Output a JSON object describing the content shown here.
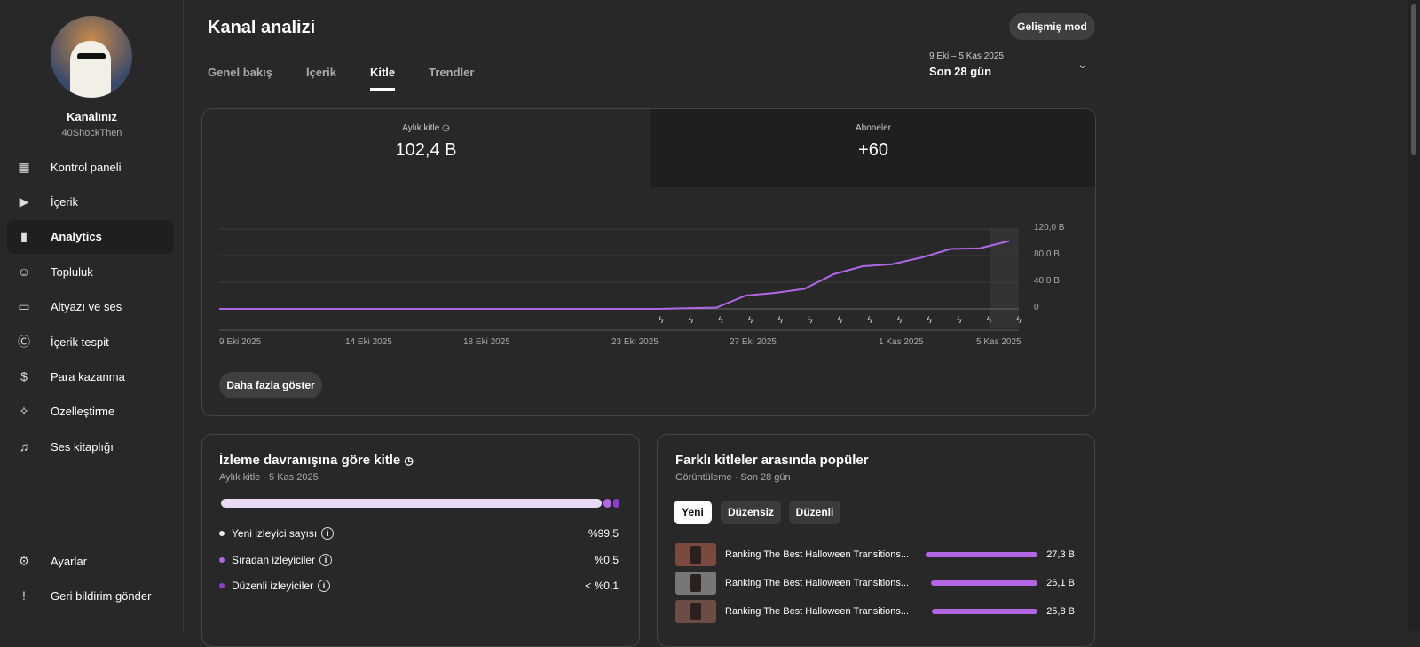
{
  "sidebar": {
    "channel_name": "Kanalınız",
    "handle": "40ShockThen",
    "items": [
      {
        "label": "Kontrol paneli",
        "icon": "dashboard-icon"
      },
      {
        "label": "İçerik",
        "icon": "content-icon"
      },
      {
        "label": "Analytics",
        "icon": "analytics-icon",
        "active": true
      },
      {
        "label": "Topluluk",
        "icon": "community-icon"
      },
      {
        "label": "Altyazı ve ses",
        "icon": "subtitles-icon"
      },
      {
        "label": "İçerik tespit",
        "icon": "copyright-icon"
      },
      {
        "label": "Para kazanma",
        "icon": "dollar-icon"
      },
      {
        "label": "Özelleştirme",
        "icon": "magic-wand-icon"
      },
      {
        "label": "Ses kitaplığı",
        "icon": "audio-library-icon"
      }
    ],
    "bottom": [
      {
        "label": "Ayarlar",
        "icon": "gear-icon"
      },
      {
        "label": "Geri bildirim gönder",
        "icon": "feedback-icon"
      }
    ]
  },
  "header": {
    "title": "Kanal analizi",
    "advanced_button": "Gelişmiş mod",
    "date_range": "9 Eki – 5 Kas 2025",
    "date_label": "Son 28 gün",
    "tabs": [
      {
        "label": "Genel bakış"
      },
      {
        "label": "İçerik"
      },
      {
        "label": "Kitle",
        "active": true
      },
      {
        "label": "Trendler"
      }
    ]
  },
  "metrics": [
    {
      "label": "Aylık kitle",
      "value": "102,4 B"
    },
    {
      "label": "Aboneler",
      "value": "+60"
    }
  ],
  "more_button": "Daha fazla göster",
  "chart_data": {
    "type": "line",
    "title": "Aylık kitle",
    "x_labels": [
      "9 Eki 2025",
      "14 Eki 2025",
      "18 Eki 2025",
      "23 Eki 2025",
      "27 Eki 2025",
      "1 Kas 2025",
      "5 Kas 2025"
    ],
    "y_ticks": [
      "0",
      "40,0 B",
      "80,0 B",
      "120,0 B"
    ],
    "ylim": [
      0,
      120
    ],
    "values": [
      0,
      0,
      0,
      0,
      0,
      0,
      0,
      0,
      0,
      0,
      0,
      0,
      0,
      0,
      0,
      0,
      1,
      2,
      20,
      24,
      30,
      52,
      64,
      67,
      77,
      90,
      91,
      102
    ],
    "color": "#b266e6"
  },
  "behavior": {
    "title": "İzleme davranışına göre kitle",
    "subtitle": "Aylık kitle · 5 Kas 2025",
    "rows": [
      {
        "label": "Yeni izleyici sayısı",
        "value": "%99,5",
        "color": "#e8daf5",
        "share": 99.5
      },
      {
        "label": "Sıradan izleyiciler",
        "value": "%0,5",
        "color": "#b266e6",
        "share": 0.5
      },
      {
        "label": "Düzenli izleyiciler",
        "value": "< %0,1",
        "color": "#8a3fcf",
        "share": 0.1
      }
    ]
  },
  "popular": {
    "title": "Farklı kitleler arasında popüler",
    "subtitle": "Görüntüleme · Son 28 gün",
    "chips": [
      "Yeni",
      "Düzensiz",
      "Düzenli"
    ],
    "videos": [
      {
        "title": "Ranking The Best Halloween Transitions...",
        "views": "27,3 B",
        "value": 27.3
      },
      {
        "title": "Ranking The Best Halloween Transitions...",
        "views": "26,1 B",
        "value": 26.1
      },
      {
        "title": "Ranking The Best Halloween Transitions...",
        "views": "25,8 B",
        "value": 25.8
      }
    ]
  }
}
